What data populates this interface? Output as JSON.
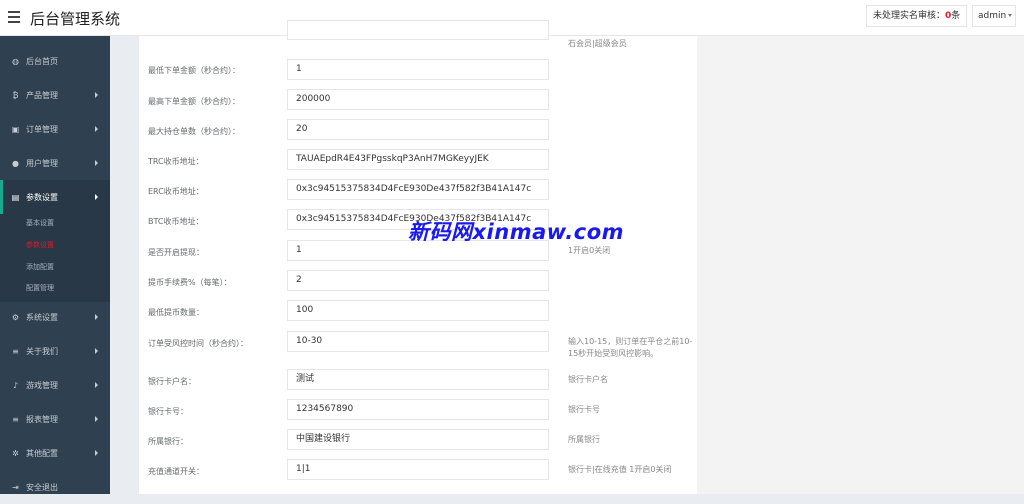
{
  "header": {
    "title": "后台管理系统",
    "pending_label": "未处理实名审核：",
    "pending_count": "0",
    "pending_unit": "条",
    "user": "admin"
  },
  "sidebar": {
    "items": [
      {
        "icon": "dashboard-icon",
        "label": "后台首页"
      },
      {
        "icon": "bitcoin-icon",
        "label": "产品管理"
      },
      {
        "icon": "clipboard-icon",
        "label": "订单管理"
      },
      {
        "icon": "user-icon",
        "label": "用户管理"
      },
      {
        "icon": "file-icon",
        "label": "参数设置"
      },
      {
        "icon": "cogs-icon",
        "label": "系统设置"
      },
      {
        "icon": "list-icon",
        "label": "关于我们"
      },
      {
        "icon": "bell-icon",
        "label": "游戏管理"
      },
      {
        "icon": "list-icon",
        "label": "报表管理"
      },
      {
        "icon": "gear-icon",
        "label": "其他配置"
      },
      {
        "icon": "sign-out-icon",
        "label": "安全退出"
      }
    ],
    "submenu": [
      "基本设置",
      "参数设置",
      "添加配置",
      "配置管理"
    ]
  },
  "form": {
    "top_hint": "石会员|超级会员",
    "rows": [
      {
        "label": "最低下单金额（秒合约）：",
        "value": "1",
        "hint": ""
      },
      {
        "label": "最高下单金额（秒合约）：",
        "value": "200000",
        "hint": ""
      },
      {
        "label": "最大持仓单数（秒合约）：",
        "value": "20",
        "hint": ""
      },
      {
        "label": "TRC收币地址：",
        "value": "TAUAEpdR4E43FPgsskqP3AnH7MGKeyyJEK",
        "hint": ""
      },
      {
        "label": "ERC收币地址：",
        "value": "0x3c94515375834D4FcE930De437f582f3B41A147c",
        "hint": ""
      },
      {
        "label": "BTC收币地址：",
        "value": "0x3c94515375834D4FcE930De437f582f3B41A147c",
        "hint": ""
      },
      {
        "label": "是否开启提现：",
        "value": "1",
        "hint": "1开启0关闭"
      },
      {
        "label": "提币手续费%（每笔）：",
        "value": "2",
        "hint": ""
      },
      {
        "label": "最低提币数量：",
        "value": "100",
        "hint": ""
      },
      {
        "label": "订单受风控时间（秒合约）：",
        "value": "10-30",
        "hint": "输入10-15，则订单在平仓之前10-15秒开始受到风控影响。"
      },
      {
        "label": "银行卡户名：",
        "value": "测试",
        "hint": "银行卡户名"
      },
      {
        "label": "银行卡号：",
        "value": "1234567890",
        "hint": "银行卡号"
      },
      {
        "label": "所属银行：",
        "value": "中国建设银行",
        "hint": "所属银行"
      },
      {
        "label": "充值通道开关：",
        "value": "1|1",
        "hint": "银行卡|在线充值 1开启0关闭"
      }
    ]
  },
  "watermark": "新码网xinmaw.com"
}
